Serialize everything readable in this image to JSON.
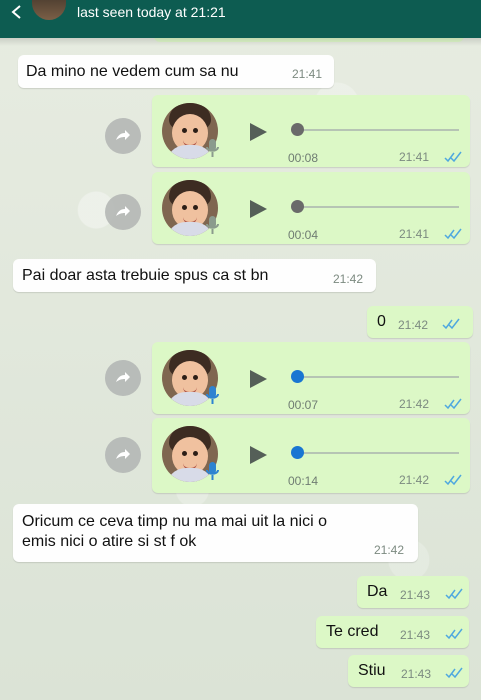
{
  "header": {
    "status": "last seen today at 21:21"
  },
  "messages": [
    {
      "type": "text",
      "direction": "incoming",
      "text": "Da mino ne vedem cum sa nu",
      "time": "21:41"
    },
    {
      "type": "voice",
      "direction": "outgoing",
      "duration": "00:08",
      "time": "21:41",
      "ticks": "double-check-icon",
      "played": false
    },
    {
      "type": "voice",
      "direction": "outgoing",
      "duration": "00:04",
      "time": "21:41",
      "ticks": "double-check-icon",
      "played": false
    },
    {
      "type": "text",
      "direction": "incoming",
      "text": "Pai doar asta trebuie spus ca st bn",
      "time": "21:42"
    },
    {
      "type": "text",
      "direction": "outgoing",
      "text": "0",
      "time": "21:42",
      "ticks": "double-check-icon"
    },
    {
      "type": "voice",
      "direction": "outgoing",
      "duration": "00:07",
      "time": "21:42",
      "ticks": "double-check-icon",
      "played": true
    },
    {
      "type": "voice",
      "direction": "outgoing",
      "duration": "00:14",
      "time": "21:42",
      "ticks": "double-check-icon",
      "played": true
    },
    {
      "type": "text",
      "direction": "incoming",
      "text": "Oricum ce ceva timp nu ma mai uit la nici o\nemis nici o atire si st f ok",
      "time": "21:42"
    },
    {
      "type": "text",
      "direction": "outgoing",
      "text": "Da",
      "time": "21:43",
      "ticks": "double-check-icon"
    },
    {
      "type": "text",
      "direction": "outgoing",
      "text": "Te cred",
      "time": "21:43",
      "ticks": "double-check-icon"
    },
    {
      "type": "text",
      "direction": "outgoing",
      "text": "Stiu",
      "time": "21:43",
      "ticks": "double-check-icon"
    }
  ],
  "colors": {
    "header": "#0d5c51",
    "incoming_bubble": "#fefefe",
    "outgoing_bubble": "#dcf8c6",
    "played_dot": "#1976d2",
    "unplayed_dot": "#6a6a6a",
    "read_ticks": "#4fa8df"
  }
}
